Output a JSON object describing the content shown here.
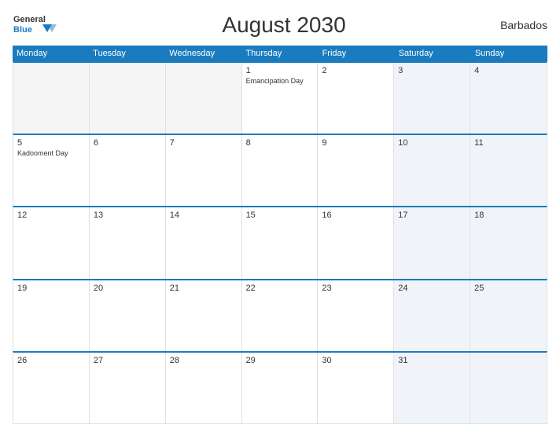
{
  "header": {
    "title": "August 2030",
    "country": "Barbados",
    "logo_general": "General",
    "logo_blue": "Blue"
  },
  "calendar": {
    "days_of_week": [
      "Monday",
      "Tuesday",
      "Wednesday",
      "Thursday",
      "Friday",
      "Saturday",
      "Sunday"
    ],
    "weeks": [
      [
        {
          "num": "",
          "holiday": "",
          "empty": true
        },
        {
          "num": "",
          "holiday": "",
          "empty": true
        },
        {
          "num": "",
          "holiday": "",
          "empty": true
        },
        {
          "num": "1",
          "holiday": "Emancipation Day",
          "empty": false
        },
        {
          "num": "2",
          "holiday": "",
          "empty": false
        },
        {
          "num": "3",
          "holiday": "",
          "empty": false,
          "weekend": true
        },
        {
          "num": "4",
          "holiday": "",
          "empty": false,
          "weekend": true
        }
      ],
      [
        {
          "num": "5",
          "holiday": "Kadooment Day",
          "empty": false
        },
        {
          "num": "6",
          "holiday": "",
          "empty": false
        },
        {
          "num": "7",
          "holiday": "",
          "empty": false
        },
        {
          "num": "8",
          "holiday": "",
          "empty": false
        },
        {
          "num": "9",
          "holiday": "",
          "empty": false
        },
        {
          "num": "10",
          "holiday": "",
          "empty": false,
          "weekend": true
        },
        {
          "num": "11",
          "holiday": "",
          "empty": false,
          "weekend": true
        }
      ],
      [
        {
          "num": "12",
          "holiday": "",
          "empty": false
        },
        {
          "num": "13",
          "holiday": "",
          "empty": false
        },
        {
          "num": "14",
          "holiday": "",
          "empty": false
        },
        {
          "num": "15",
          "holiday": "",
          "empty": false
        },
        {
          "num": "16",
          "holiday": "",
          "empty": false
        },
        {
          "num": "17",
          "holiday": "",
          "empty": false,
          "weekend": true
        },
        {
          "num": "18",
          "holiday": "",
          "empty": false,
          "weekend": true
        }
      ],
      [
        {
          "num": "19",
          "holiday": "",
          "empty": false
        },
        {
          "num": "20",
          "holiday": "",
          "empty": false
        },
        {
          "num": "21",
          "holiday": "",
          "empty": false
        },
        {
          "num": "22",
          "holiday": "",
          "empty": false
        },
        {
          "num": "23",
          "holiday": "",
          "empty": false
        },
        {
          "num": "24",
          "holiday": "",
          "empty": false,
          "weekend": true
        },
        {
          "num": "25",
          "holiday": "",
          "empty": false,
          "weekend": true
        }
      ],
      [
        {
          "num": "26",
          "holiday": "",
          "empty": false
        },
        {
          "num": "27",
          "holiday": "",
          "empty": false
        },
        {
          "num": "28",
          "holiday": "",
          "empty": false
        },
        {
          "num": "29",
          "holiday": "",
          "empty": false
        },
        {
          "num": "30",
          "holiday": "",
          "empty": false
        },
        {
          "num": "31",
          "holiday": "",
          "empty": false,
          "weekend": true
        },
        {
          "num": "",
          "holiday": "",
          "empty": true,
          "weekend": true
        }
      ]
    ]
  }
}
